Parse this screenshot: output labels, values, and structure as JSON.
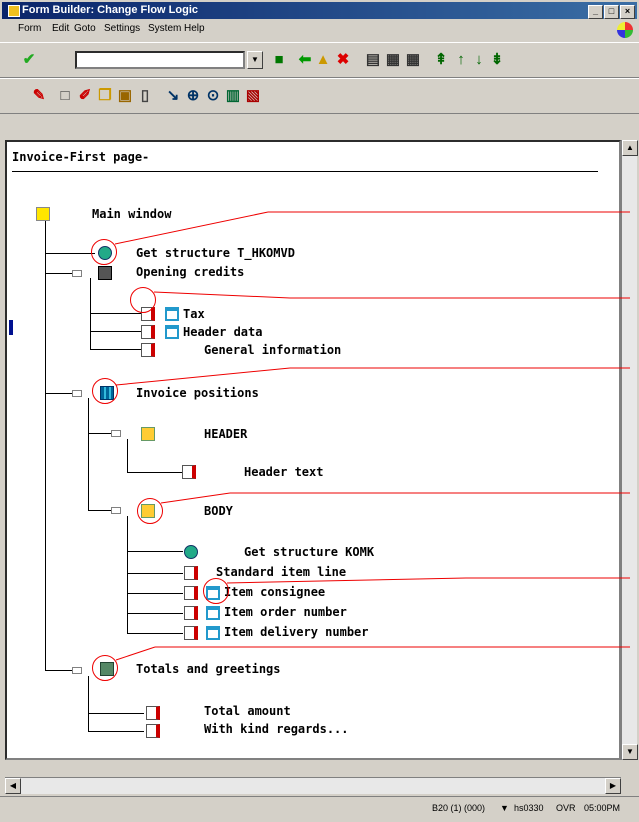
{
  "window": {
    "title": "Form Builder: Change Flow Logic",
    "controls": [
      "_",
      "□",
      "×"
    ]
  },
  "menu": [
    "Form",
    "Edit",
    "Goto",
    "Settings",
    "System",
    "Help"
  ],
  "toolbar": {
    "command_field_value": ""
  },
  "page_title": "Invoice-First page-",
  "tree": {
    "main_window": "Main window",
    "get_structure_1": "Get structure T_HKOMVD",
    "opening_credits": "Opening credits",
    "tax": "Tax",
    "header_data": "Header data",
    "general_information": "General information",
    "invoice_positions": "Invoice positions",
    "header": "HEADER",
    "header_text": "Header text",
    "body": "BODY",
    "get_structure_2": "Get structure KOMK",
    "standard_item_line": "Standard item line",
    "item_consignee": "Item consignee",
    "item_order_number": "Item order number",
    "item_delivery_number": "Item delivery number",
    "totals_and_greetings": "Totals and greetings",
    "total_amount": "Total amount",
    "with_kind_regards": "With kind regards..."
  },
  "status": {
    "system": "B20 (1) (000)",
    "server": "hs0330",
    "mode": "OVR",
    "time": "05:00PM"
  },
  "colors": {
    "annotation": "#e00000",
    "titlebar": "#0a246a"
  }
}
